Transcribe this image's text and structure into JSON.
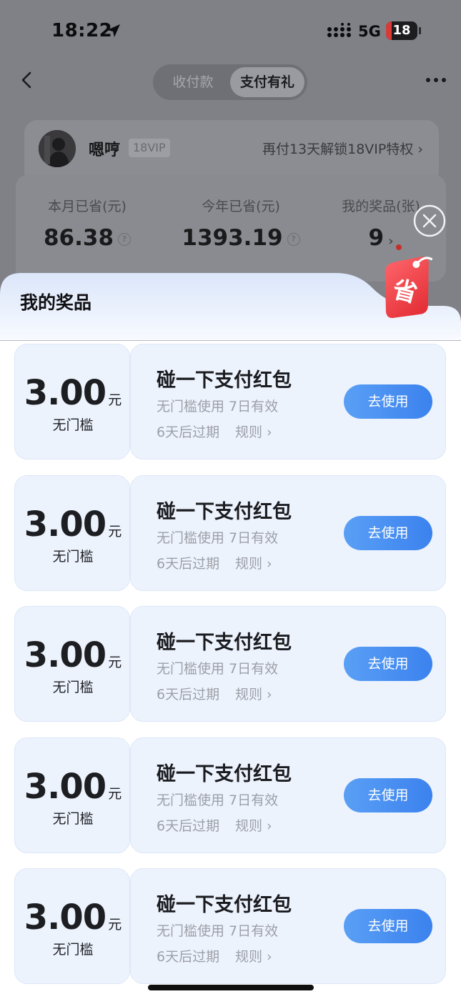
{
  "status_bar": {
    "time": "18:22",
    "network": "5G",
    "battery": "18",
    "battery_fraction": 0.18
  },
  "header": {
    "tabs": [
      "收付款",
      "支付有礼"
    ],
    "active_tab": "支付有礼"
  },
  "user": {
    "name": "嗯哼",
    "vip": "18VIP",
    "vip_link": "再付13天解锁18VIP特权 ›"
  },
  "stats": [
    {
      "label": "本月已省(元)",
      "value": "86.38"
    },
    {
      "label": "今年已省(元)",
      "value": "1393.19"
    },
    {
      "label": "我的奖品(张)",
      "value": "9"
    }
  ],
  "sheet": {
    "title": "我的奖品",
    "tag_text": "省",
    "coupons": [
      {
        "amount": "3.00",
        "unit": "元",
        "threshold": "无门槛",
        "title": "碰一下支付红包",
        "desc": "无门槛使用 7日有效",
        "expire": "6天后过期",
        "rules": "规则 ›",
        "button": "去使用"
      },
      {
        "amount": "3.00",
        "unit": "元",
        "threshold": "无门槛",
        "title": "碰一下支付红包",
        "desc": "无门槛使用 7日有效",
        "expire": "6天后过期",
        "rules": "规则 ›",
        "button": "去使用"
      },
      {
        "amount": "3.00",
        "unit": "元",
        "threshold": "无门槛",
        "title": "碰一下支付红包",
        "desc": "无门槛使用 7日有效",
        "expire": "6天后过期",
        "rules": "规则 ›",
        "button": "去使用"
      },
      {
        "amount": "3.00",
        "unit": "元",
        "threshold": "无门槛",
        "title": "碰一下支付红包",
        "desc": "无门槛使用 7日有效",
        "expire": "6天后过期",
        "rules": "规则 ›",
        "button": "去使用"
      },
      {
        "amount": "3.00",
        "unit": "元",
        "threshold": "无门槛",
        "title": "碰一下支付红包",
        "desc": "无门槛使用 7日有效",
        "expire": "6天后过期",
        "rules": "规则 ›",
        "button": "去使用"
      }
    ]
  },
  "colors": {
    "accent": "#3b82ee",
    "coupon_bg": "#edf3fd",
    "tag_red": "#e8383f"
  },
  "icons": [
    "location-arrow-icon",
    "signal-icon",
    "back-icon",
    "more-icon",
    "close-icon",
    "tag-icon",
    "question-icon"
  ]
}
